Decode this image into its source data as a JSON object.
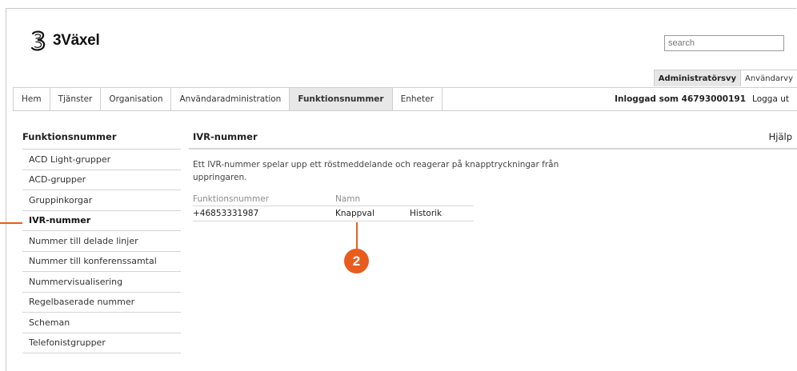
{
  "brand": {
    "name": "3Växel",
    "logo_icon": "three-logo-icon"
  },
  "search": {
    "placeholder": "search"
  },
  "view_tabs": [
    {
      "label": "Administratörsvy",
      "active": true
    },
    {
      "label": "Användarvy",
      "active": false
    }
  ],
  "nav": {
    "items": [
      {
        "label": "Hem"
      },
      {
        "label": "Tjänster"
      },
      {
        "label": "Organisation"
      },
      {
        "label": "Användaradministration"
      },
      {
        "label": "Funktionsnummer",
        "active": true
      },
      {
        "label": "Enheter"
      }
    ],
    "logged_in": "Inloggad som 46793000191",
    "logout": "Logga ut"
  },
  "sidebar": {
    "title": "Funktionsnummer",
    "items": [
      {
        "label": "ACD Light-grupper"
      },
      {
        "label": "ACD-grupper"
      },
      {
        "label": "Gruppinkorgar"
      },
      {
        "label": "IVR-nummer",
        "active": true
      },
      {
        "label": "Nummer till delade linjer"
      },
      {
        "label": "Nummer till konferenssamtal"
      },
      {
        "label": "Nummervisualisering"
      },
      {
        "label": "Regelbaserade nummer"
      },
      {
        "label": "Scheman"
      },
      {
        "label": "Telefonistgrupper"
      }
    ]
  },
  "main": {
    "title": "IVR-nummer",
    "help": "Hjälp",
    "description": "Ett IVR-nummer spelar upp ett röstmeddelande och reagerar på knapptryckningar från uppringaren.",
    "table": {
      "headers": [
        "Funktionsnummer",
        "Namn"
      ],
      "rows": [
        {
          "number": "+46853331987",
          "name": "Knappval",
          "action": "Historik"
        }
      ]
    }
  },
  "annotation": {
    "number": "2",
    "color": "#e85d1e"
  }
}
